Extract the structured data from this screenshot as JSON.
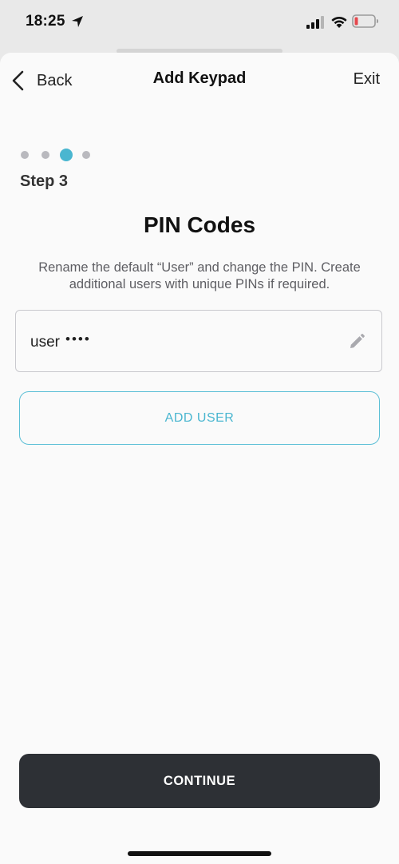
{
  "status_bar": {
    "time": "18:25",
    "icons": [
      "location-arrow-icon",
      "signal-icon",
      "wifi-icon",
      "battery-low-icon"
    ],
    "battery_color": "#e5484d"
  },
  "nav": {
    "back_label": "Back",
    "title": "Add Keypad",
    "exit_label": "Exit"
  },
  "stepper": {
    "total_steps": 4,
    "current_step": 3,
    "active_color": "#4ab6d0",
    "inactive_color": "#b9b9be"
  },
  "step_label": "Step 3",
  "page_title": "PIN Codes",
  "description": "Rename the default “User” and change the PIN. Create additional users with unique PINs if required.",
  "users": [
    {
      "name": "user",
      "pin_mask": "••••"
    }
  ],
  "add_user_label": "ADD USER",
  "continue_label": "CONTINUE",
  "colors": {
    "accent": "#4ab6d0",
    "primary_button": "#2d3035"
  }
}
